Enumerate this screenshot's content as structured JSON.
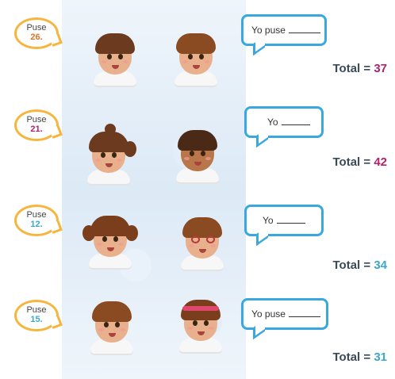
{
  "rows": [
    {
      "said_word": "Puse",
      "said_number": "26.",
      "said_number_color": "#e0722a",
      "answer_text": "Yo puse",
      "total_label": "Total",
      "total_eq": "=",
      "total_value": "37",
      "total_value_color": "#b4226a"
    },
    {
      "said_word": "Puse",
      "said_number": "21.",
      "said_number_color": "#b4226a",
      "answer_text": "Yo",
      "total_label": "Total",
      "total_eq": "=",
      "total_value": "42",
      "total_value_color": "#b4226a"
    },
    {
      "said_word": "Puse",
      "said_number": "12.",
      "said_number_color": "#3aa8c9",
      "answer_text": "Yo",
      "total_label": "Total",
      "total_eq": "=",
      "total_value": "34",
      "total_value_color": "#3aa8c9"
    },
    {
      "said_word": "Puse",
      "said_number": "15.",
      "said_number_color": "#3aa8c9",
      "answer_text": "Yo puse",
      "total_label": "Total",
      "total_eq": "=",
      "total_value": "31",
      "total_value_color": "#3aa8c9"
    }
  ],
  "colors": {
    "speech_border": "#f6b53e",
    "answer_border": "#3aa8e0",
    "total_text": "#3a4a5a"
  }
}
